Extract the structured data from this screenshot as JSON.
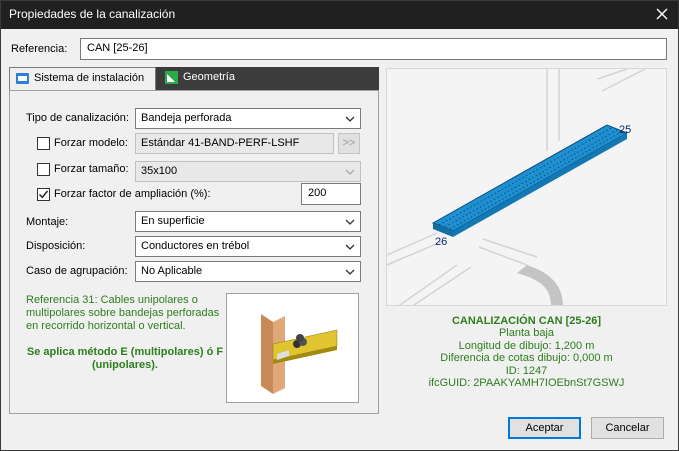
{
  "window": {
    "title": "Propiedades de la canalización"
  },
  "referencia": {
    "label": "Referencia:",
    "value": "CAN [25-26]"
  },
  "tabs": [
    {
      "label": "Sistema de instalación"
    },
    {
      "label": "Geometría"
    }
  ],
  "form": {
    "tipo": {
      "label": "Tipo de canalización:",
      "value": "Bandeja perforada"
    },
    "forzar_modelo": {
      "label": "Forzar modelo:",
      "checked": false,
      "value": "Estándar 41-BAND-PERF-LSHF",
      "button": ">>"
    },
    "forzar_tamano": {
      "label": "Forzar tamaño:",
      "checked": false,
      "value": "35x100"
    },
    "forzar_factor": {
      "label": "Forzar factor de ampliación (%):",
      "checked": true,
      "value": "200"
    },
    "montaje": {
      "label": "Montaje:",
      "value": "En superficie"
    },
    "disposicion": {
      "label": "Disposición:",
      "value": "Conductores en trébol"
    },
    "agrupacion": {
      "label": "Caso de agrupación:",
      "value": "No Aplicable"
    }
  },
  "note": {
    "text": "Referencia 31: Cables unipolares o multipolares sobre bandejas perforadas en recorrido horizontal o vertical.",
    "method": "Se aplica método E (multipolares) ó F (unipolares)."
  },
  "preview": {
    "node_start": "25",
    "node_end": "26"
  },
  "info": {
    "title": "CANALIZACIÓN CAN [25-26]",
    "lines": [
      "Planta baja",
      "Longitud de dibujo: 1,200 m",
      "Diferencia de cotas dibujo: 0,000 m",
      "ID: 1247",
      "ifcGUID: 2PAAKYAMH7IOEbnSt7GSWJ"
    ]
  },
  "buttons": {
    "accept": "Aceptar",
    "cancel": "Cancelar"
  },
  "colors": {
    "accent_green": "#2e7d1e",
    "tray_blue": "#1e8fd0",
    "titlebar": "#202020"
  },
  "icons": {
    "close": "close-icon",
    "tab1": "installation-system-icon",
    "tab2": "geometry-icon"
  }
}
